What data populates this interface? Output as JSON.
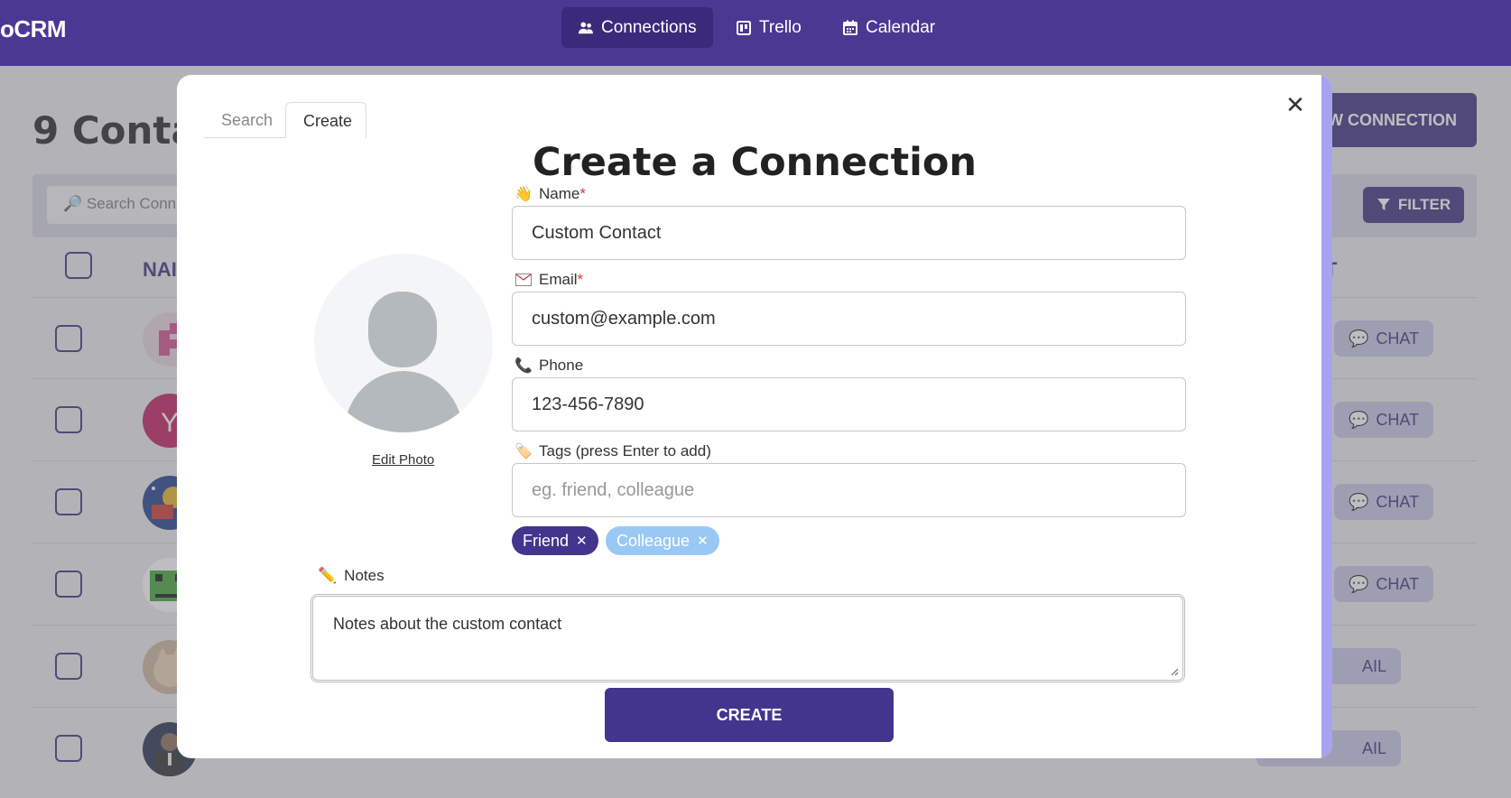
{
  "app": {
    "brand": "oCRM"
  },
  "nav": [
    {
      "label": "Connections",
      "icon": "users-icon",
      "active": true
    },
    {
      "label": "Trello",
      "icon": "board-icon",
      "active": false
    },
    {
      "label": "Calendar",
      "icon": "calendar-icon",
      "active": false
    }
  ],
  "page": {
    "title": "9 Conta",
    "new_button": "EW CONNECTION",
    "search_placeholder": "Search Conn",
    "filter_label": "FILTER",
    "column_name": "NAI",
    "column_last": "T",
    "row_actions": [
      "CHAT",
      "CHAT",
      "CHAT",
      "CHAT",
      "AIL",
      "AIL"
    ]
  },
  "modal": {
    "tabs": {
      "search": "Search",
      "create": "Create"
    },
    "title": "Create a Connection",
    "edit_photo": "Edit Photo",
    "name": {
      "label": "Name",
      "required": "*",
      "value": "Custom Contact",
      "icon": "waving-hand-icon"
    },
    "email": {
      "label": "Email",
      "required": "*",
      "value": "custom@example.com",
      "icon": "envelope-icon"
    },
    "phone": {
      "label": "Phone",
      "value": "123-456-7890",
      "icon": "telephone-icon"
    },
    "tags": {
      "label": "Tags (press Enter to add)",
      "placeholder": "eg. friend, colleague",
      "icon": "tag-icon"
    },
    "chips": [
      {
        "label": "Friend",
        "color": "#43358e"
      },
      {
        "label": "Colleague",
        "color": "#99c8f5"
      }
    ],
    "notes": {
      "label": "Notes",
      "value": "Notes about the custom contact",
      "icon": "pencil-icon"
    },
    "create_button": "CREATE",
    "close_symbol": "✕"
  },
  "colors": {
    "primary": "#4a3893",
    "primary_dark": "#3a2a7c",
    "accent_scroll": "#a8a2f0"
  }
}
